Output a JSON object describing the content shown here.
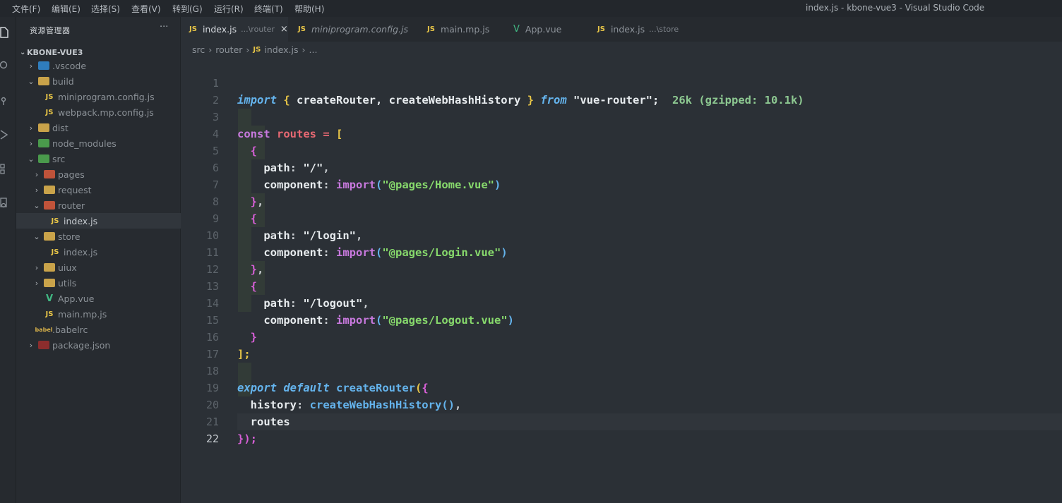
{
  "menu": [
    "文件(F)",
    "编辑(E)",
    "选择(S)",
    "查看(V)",
    "转到(G)",
    "运行(R)",
    "终端(T)",
    "帮助(H)"
  ],
  "window_title": "index.js - kbone-vue3 - Visual Studio Code",
  "explorer": {
    "title": "资源管理器",
    "more": "···",
    "project": "KBONE-VUE3",
    "items": [
      {
        "label": ".vscode"
      },
      {
        "label": "build"
      },
      {
        "label": "miniprogram.config.js"
      },
      {
        "label": "webpack.mp.config.js"
      },
      {
        "label": "dist"
      },
      {
        "label": "node_modules"
      },
      {
        "label": "src"
      },
      {
        "label": "pages"
      },
      {
        "label": "request"
      },
      {
        "label": "router"
      },
      {
        "label": "index.js"
      },
      {
        "label": "store"
      },
      {
        "label": "index.js"
      },
      {
        "label": "uiux"
      },
      {
        "label": "utils"
      },
      {
        "label": "App.vue"
      },
      {
        "label": "main.mp.js"
      },
      {
        "label": ".babelrc"
      },
      {
        "label": "package.json"
      }
    ]
  },
  "tabs": [
    {
      "label": "index.js",
      "desc": "...\\router"
    },
    {
      "label": "miniprogram.config.js",
      "desc": ""
    },
    {
      "label": "main.mp.js",
      "desc": ""
    },
    {
      "label": "App.vue",
      "desc": ""
    },
    {
      "label": "index.js",
      "desc": "...\\store"
    }
  ],
  "breadcrumb": [
    "src",
    "router",
    "index.js",
    "..."
  ],
  "icons": {
    "js": "JS",
    "vue": "V",
    "close": "×",
    "chevron_right": "›",
    "chevron_down": "⌄",
    "sep": "›"
  },
  "code": {
    "line1": {
      "import": "import",
      "brace_open": "{",
      "names": " createRouter, createWebHashHistory ",
      "brace_close": "}",
      "from": "from",
      "module": "\"vue-router\";",
      "size": "26k (gzipped: 10.1k)"
    },
    "line3": {
      "const": "const",
      "name": "routes",
      "eq": "=",
      "bracket": "["
    },
    "routes": [
      {
        "path_key": "path",
        "path_val": "\"/\"",
        "comp_key": "component",
        "import": "import",
        "comp_val": "\"@pages/Home.vue\""
      },
      {
        "path_key": "path",
        "path_val": "\"/login\"",
        "comp_key": "component",
        "import": "import",
        "comp_val": "\"@pages/Login.vue\""
      },
      {
        "path_key": "path",
        "path_val": "\"/logout\"",
        "comp_key": "component",
        "import": "import",
        "comp_val": "\"@pages/Logout.vue\""
      }
    ],
    "line16": "];",
    "line18": {
      "export": "export",
      "default": "default",
      "fn": "createRouter"
    },
    "line19": {
      "key": "history",
      "fn": "createWebHashHistory"
    },
    "line20": "routes",
    "line21": "});"
  },
  "line_numbers": [
    "1",
    "2",
    "3",
    "4",
    "5",
    "6",
    "7",
    "8",
    "9",
    "10",
    "11",
    "12",
    "13",
    "14",
    "15",
    "16",
    "17",
    "18",
    "19",
    "20",
    "21",
    "22"
  ]
}
